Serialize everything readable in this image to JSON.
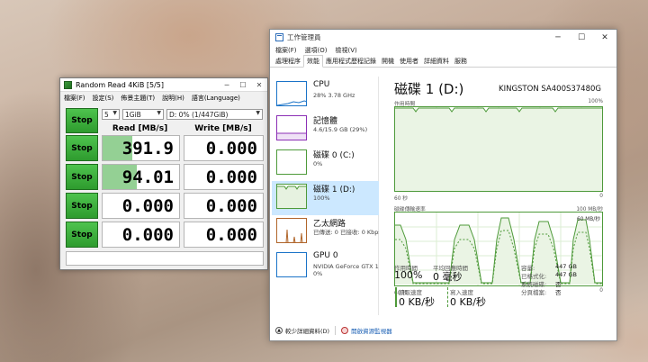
{
  "cdm": {
    "title": "Random Read 4KiB [5/5]",
    "menu": [
      "檔案(F)",
      "設定(S)",
      "佈景主題(T)",
      "說明(H)",
      "語言(Language)"
    ],
    "count": "5",
    "size": "1GiB",
    "drive": "D: 0% (1/447GiB)",
    "all_label": "Stop",
    "read_header": "Read [MB/s]",
    "write_header": "Write [MB/s]",
    "rows": [
      {
        "label": "Stop",
        "read": "391.9",
        "write": "0.000",
        "read_fill": 0.39
      },
      {
        "label": "Stop",
        "read": "94.01",
        "write": "0.000",
        "read_fill": 0.45
      },
      {
        "label": "Stop",
        "read": "0.000",
        "write": "0.000",
        "read_fill": 0
      },
      {
        "label": "Stop",
        "read": "0.000",
        "write": "0.000",
        "read_fill": 0
      }
    ],
    "colors": {
      "button": "#3cb43c",
      "bar": "#3caa3c"
    }
  },
  "tm": {
    "title": "工作管理員",
    "menu": [
      "檔案(F)",
      "選項(O)",
      "檢視(V)"
    ],
    "tabs": [
      "處理程序",
      "效能",
      "應用程式歷程記錄",
      "開機",
      "使用者",
      "詳細資料",
      "服務"
    ],
    "active_tab": "效能",
    "items": [
      {
        "name": "CPU",
        "sub": "28%  3.78 GHz",
        "color": "#1a73c8"
      },
      {
        "name": "記憶體",
        "sub": "4.6/15.9 GB (29%)",
        "color": "#8b2fb5"
      },
      {
        "name": "磁碟 0 (C:)",
        "sub": "0%",
        "color": "#4e9a3a"
      },
      {
        "name": "磁碟 1 (D:)",
        "sub": "100%",
        "color": "#4e9a3a"
      },
      {
        "name": "乙太網路",
        "sub": "已傳送: 0 已接收: 0 Kbps",
        "color": "#b0652a"
      },
      {
        "name": "GPU 0",
        "sub": "NVIDIA GeForce GTX 1\n0%",
        "color": "#1a73c8"
      }
    ],
    "detail": {
      "title": "磁碟 1 (D:)",
      "model": "KINGSTON SA400S37480G",
      "g1_label": "作用時間",
      "g1_max": "100%",
      "g1_left": "60 秒",
      "g1_right": "0",
      "g2_label": "磁碟傳輸速率",
      "g2_max": "100 MB/秒",
      "g2_mark": "60 MB/秒",
      "g2_left": "60 秒",
      "g2_right": "0",
      "active_time_label": "作用時間",
      "active_time_value": "100%",
      "response_label": "平均回應時間",
      "response_value": "0 毫秒",
      "read_label": "讀取速度",
      "read_value": "0 KB/秒",
      "write_label": "寫入速度",
      "write_value": "0 KB/秒",
      "info": [
        {
          "k": "容量:",
          "v": "447 GB"
        },
        {
          "k": "已格式化:",
          "v": "447 GB"
        },
        {
          "k": "系統磁碟:",
          "v": "否"
        },
        {
          "k": "分頁檔案:",
          "v": "否"
        }
      ]
    },
    "footer": {
      "less": "較少詳細資料(D)",
      "resmon": "開啟資源監視器"
    },
    "colors": {
      "disk": "#4e9a3a",
      "selected": "#cce8ff"
    }
  }
}
